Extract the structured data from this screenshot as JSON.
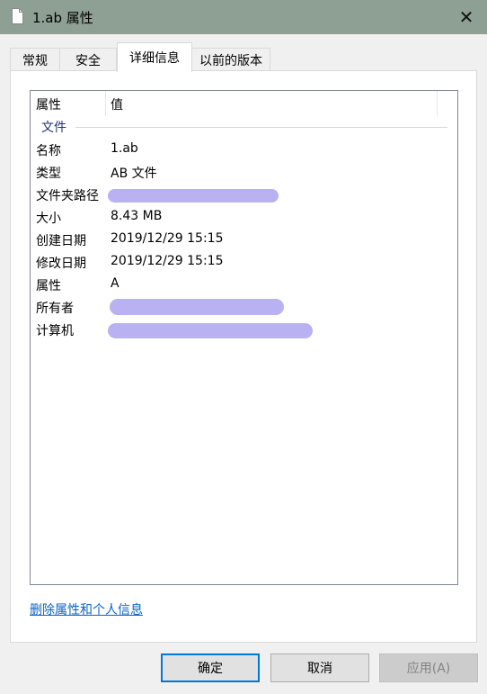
{
  "window": {
    "title": "1.ab 属性",
    "icon": "file-icon",
    "close_glyph": "✕"
  },
  "tabs": [
    {
      "label": "常规",
      "active": false
    },
    {
      "label": "安全",
      "active": false
    },
    {
      "label": "详细信息",
      "active": true
    },
    {
      "label": "以前的版本",
      "active": false
    }
  ],
  "details": {
    "columns": {
      "property": "属性",
      "value": "值"
    },
    "group": "文件",
    "rows": [
      {
        "name": "名称",
        "value": "1.ab"
      },
      {
        "name": "类型",
        "value": "AB 文件"
      },
      {
        "name": "文件夹路径",
        "value": ""
      },
      {
        "name": "大小",
        "value": "8.43 MB"
      },
      {
        "name": "创建日期",
        "value": "2019/12/29 15:15"
      },
      {
        "name": "修改日期",
        "value": "2019/12/29 15:15"
      },
      {
        "name": "属性",
        "value": "A"
      },
      {
        "name": "所有者",
        "value": ""
      },
      {
        "name": "计算机",
        "value": ""
      }
    ]
  },
  "link_remove_properties": "删除属性和个人信息",
  "buttons": {
    "ok": "确定",
    "cancel": "取消",
    "apply": "应用(A)"
  },
  "colors": {
    "titlebar": "#8e9f93",
    "accent": "#0078d7",
    "link": "#0a64c8",
    "group": "#1e3287",
    "redaction": "#b9b2f2"
  }
}
